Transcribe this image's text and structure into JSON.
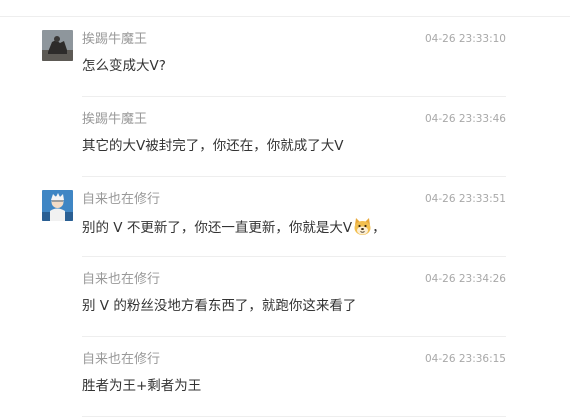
{
  "comments": [
    {
      "author": "挨踢牛魔王",
      "time": "04-26 23:33:10",
      "text": "怎么变成大V?",
      "has_avatar": true
    },
    {
      "author": "挨踢牛魔王",
      "time": "04-26 23:33:46",
      "text": "其它的大V被封完了，你还在，你就成了大V",
      "has_avatar": false
    },
    {
      "author": "自来也在修行",
      "time": "04-26 23:33:51",
      "text": "别的 V 不更新了，你还一直更新，你就是大V",
      "text_suffix": "，",
      "emoji": "doge-emoji",
      "has_avatar": true
    },
    {
      "author": "自来也在修行",
      "time": "04-26 23:34:26",
      "text": "别 V 的粉丝没地方看东西了，就跑你这来看了",
      "has_avatar": false
    },
    {
      "author": "自来也在修行",
      "time": "04-26 23:36:15",
      "text": "胜者为王+剩者为王",
      "has_avatar": false
    }
  ]
}
